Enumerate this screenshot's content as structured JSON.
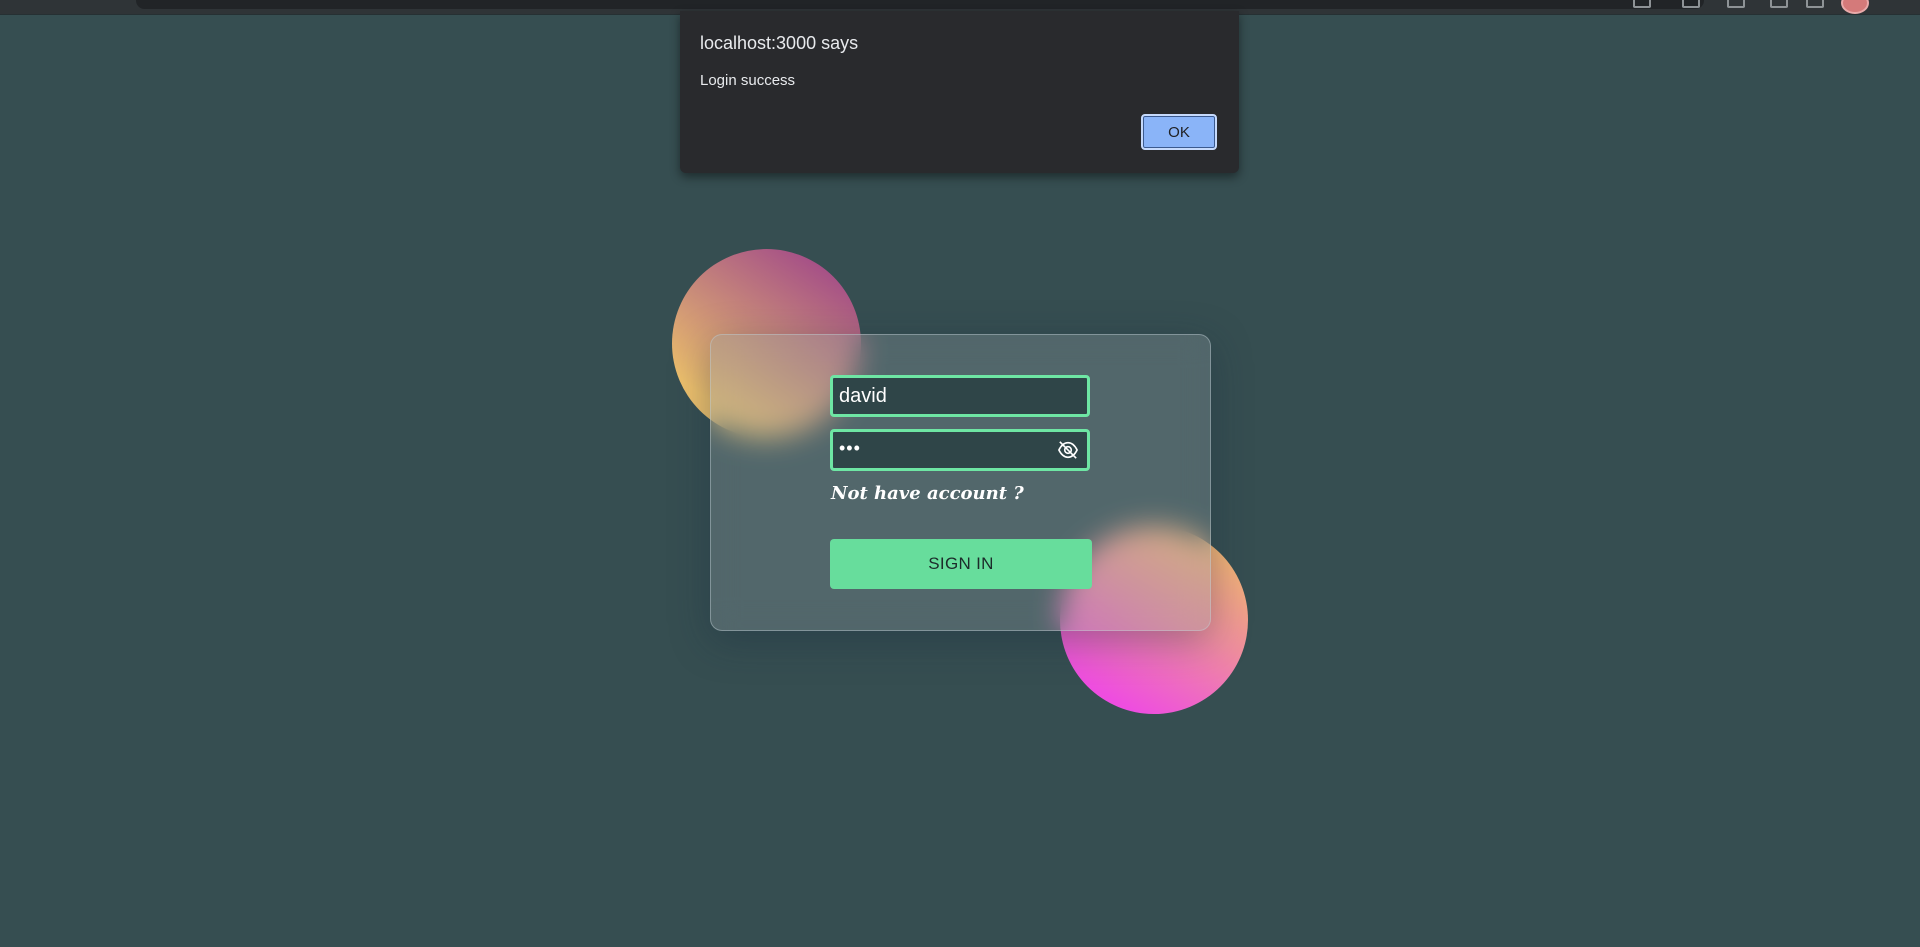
{
  "alert": {
    "title": "localhost:3000 says",
    "message": "Login success",
    "ok_label": "OK"
  },
  "login_form": {
    "username_value": "david",
    "password_value": "•••",
    "signup_link": "Not have account ?",
    "signin_label": "SIGN IN"
  },
  "icons": {
    "password_toggle": "eye-slash-icon"
  },
  "colors": {
    "background": "#364e51",
    "field_border": "#6ee6a4",
    "button": "#67dd9c",
    "dialog_bg": "#292a2d",
    "dialog_button": "#8ab4f8"
  }
}
